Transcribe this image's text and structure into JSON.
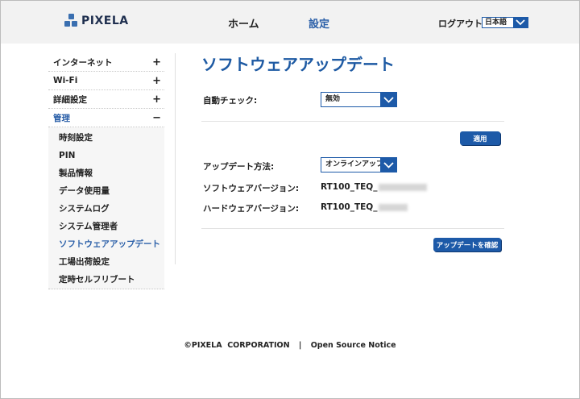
{
  "header": {
    "logo_text": "PIXELA",
    "nav_home": "ホーム",
    "nav_settings": "設定",
    "logout": "ログアウト",
    "language_value": "日本語"
  },
  "sidebar": {
    "sections": [
      {
        "label": "インターネット",
        "toggle": "+"
      },
      {
        "label": "Wi-Fi",
        "toggle": "+"
      },
      {
        "label": "詳細設定",
        "toggle": "+"
      },
      {
        "label": "管理",
        "toggle": "−"
      }
    ],
    "sub_items": [
      "時刻設定",
      "PIN",
      "製品情報",
      "データ使用量",
      "システムログ",
      "システム管理者",
      "ソフトウェアアップデート",
      "工場出荷設定",
      "定時セルフリブート"
    ],
    "active_sub_item_index": 6
  },
  "main": {
    "title": "ソフトウェアアップデート",
    "auto_check_label": "自動チェック:",
    "auto_check_value": "無効",
    "apply_button": "適用",
    "update_method_label": "アップデート方法:",
    "update_method_value": "オンラインアップ",
    "software_version_label": "ソフトウェアバージョン:",
    "software_version_value": "RT100_TEQ_",
    "hardware_version_label": "ハードウェアバージョン:",
    "hardware_version_value": "RT100_TEQ_",
    "check_update_button": "アップデートを確認"
  },
  "footer": {
    "copyright": "©PIXELA  CORPORATION",
    "separator": "|",
    "open_source": "Open Source Notice"
  },
  "colors": {
    "accent": "#1d5aa8",
    "title": "#1e5aa3",
    "header_bg": "#f2f2f2"
  }
}
